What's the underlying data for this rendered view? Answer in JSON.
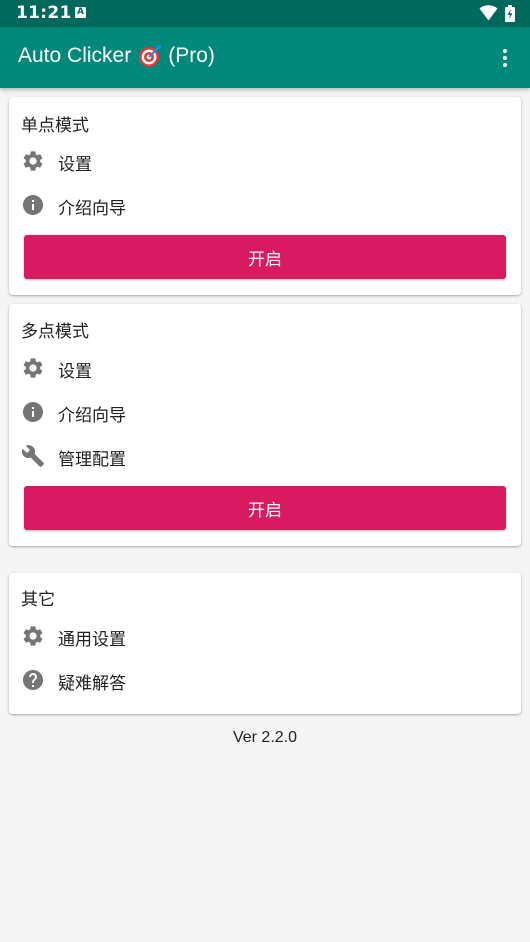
{
  "status_bar": {
    "time": "11:21",
    "notification_glyph": "A",
    "icons": [
      "wifi-icon",
      "battery-icon"
    ]
  },
  "app_bar": {
    "title_prefix": "Auto Clicker",
    "title_suffix": "(Pro)",
    "title_icon": "target-icon",
    "menu_icon": "more-vert-icon",
    "color": "#00897b"
  },
  "single_mode": {
    "title": "单点模式",
    "items": [
      {
        "label": "设置",
        "icon": "gear-icon"
      },
      {
        "label": "介绍向导",
        "icon": "info-icon"
      }
    ],
    "start_label": "开启"
  },
  "multi_mode": {
    "title": "多点模式",
    "items": [
      {
        "label": "设置",
        "icon": "gear-icon"
      },
      {
        "label": "介绍向导",
        "icon": "info-icon"
      },
      {
        "label": "管理配置",
        "icon": "wrench-icon"
      }
    ],
    "start_label": "开启"
  },
  "other": {
    "title": "其它",
    "items": [
      {
        "label": "通用设置",
        "icon": "gear-icon"
      },
      {
        "label": "疑难解答",
        "icon": "help-icon"
      }
    ]
  },
  "version": "Ver 2.2.0",
  "colors": {
    "status_bar": "#00695c",
    "accent_button": "#d81b60",
    "icon_gray": "#757575"
  }
}
